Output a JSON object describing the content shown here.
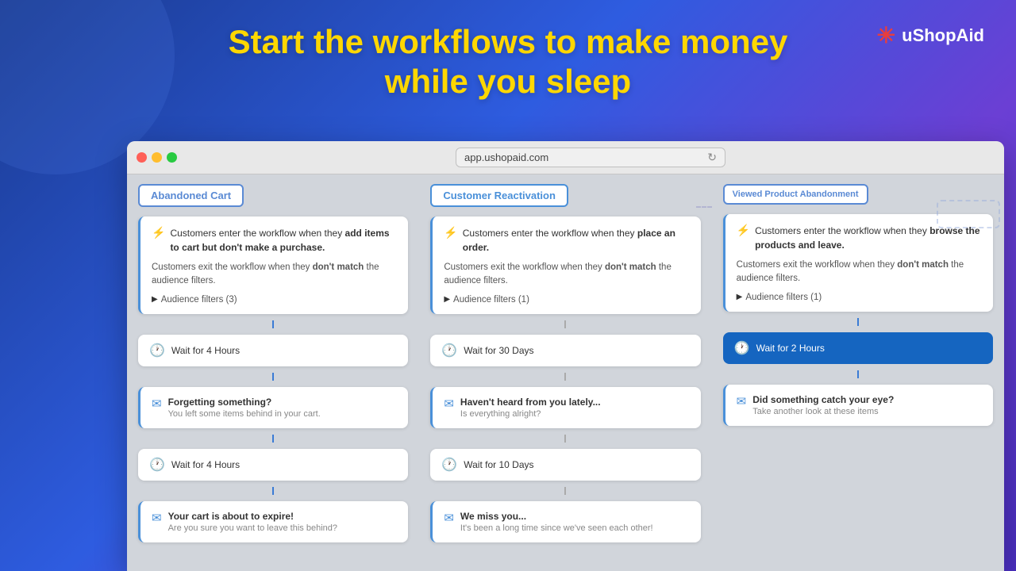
{
  "header": {
    "line1": "Start the workflows to make money",
    "line2": "while you sleep"
  },
  "logo": {
    "name": "uShopAid",
    "icon": "✳"
  },
  "browser": {
    "url": "app.ushopaid.com"
  },
  "columns": [
    {
      "id": "abandoned-cart",
      "tab_label": "Abandoned Cart",
      "tab_class": "abandoned",
      "nodes": [
        {
          "type": "trigger",
          "entry_text_start": "Customers enter the workflow when they ",
          "entry_bold": "add items to cart but don't make a purchase.",
          "exit_text": "Customers exit the workflow when they ",
          "exit_bold": "don't match",
          "exit_text_end": " the audience filters.",
          "audience": "Audience filters (3)"
        },
        {
          "type": "connector"
        },
        {
          "type": "wait",
          "label": "Wait for 4 Hours"
        },
        {
          "type": "connector"
        },
        {
          "type": "email",
          "title": "Forgetting something?",
          "preview": "You left some items behind in your cart."
        },
        {
          "type": "connector"
        },
        {
          "type": "wait",
          "label": "Wait for 4 Hours"
        },
        {
          "type": "connector"
        },
        {
          "type": "email",
          "title": "Your cart is about to expire!",
          "preview": "Are you sure you want to leave this behind?"
        }
      ]
    },
    {
      "id": "customer-reactivation",
      "tab_label": "Customer Reactivation",
      "tab_class": "reactivation",
      "nodes": [
        {
          "type": "trigger",
          "entry_text_start": "Customers enter the workflow when they ",
          "entry_bold": "place an order.",
          "exit_text": "Customers exit the workflow when they ",
          "exit_bold": "don't match",
          "exit_text_end": " the audience filters.",
          "audience": "Audience filters (1)"
        },
        {
          "type": "connector"
        },
        {
          "type": "wait",
          "label": "Wait for 30 Days"
        },
        {
          "type": "connector"
        },
        {
          "type": "email",
          "title": "Haven't heard from you lately...",
          "preview": "Is everything alright?"
        },
        {
          "type": "connector"
        },
        {
          "type": "wait",
          "label": "Wait for 10 Days"
        },
        {
          "type": "connector"
        },
        {
          "type": "email",
          "title": "We miss you...",
          "preview": "It's been a long time since we've seen each other!"
        }
      ]
    },
    {
      "id": "viewed-product-abandonment",
      "tab_label": "Viewed Product Abandonment",
      "tab_class": "viewed",
      "nodes": [
        {
          "type": "trigger",
          "entry_text_start": "Customers enter the workflow when they ",
          "entry_bold": "browse the products and leave.",
          "exit_text": "Customers exit the workflow when they ",
          "exit_bold": "don't match",
          "exit_text_end": " the audience filters.",
          "audience": "Audience filters (1)"
        },
        {
          "type": "connector"
        },
        {
          "type": "wait_highlight",
          "label": "Wait for 2 Hours"
        },
        {
          "type": "connector"
        },
        {
          "type": "email",
          "title": "Did something catch your eye?",
          "preview": "Take another look at these items"
        }
      ]
    }
  ]
}
